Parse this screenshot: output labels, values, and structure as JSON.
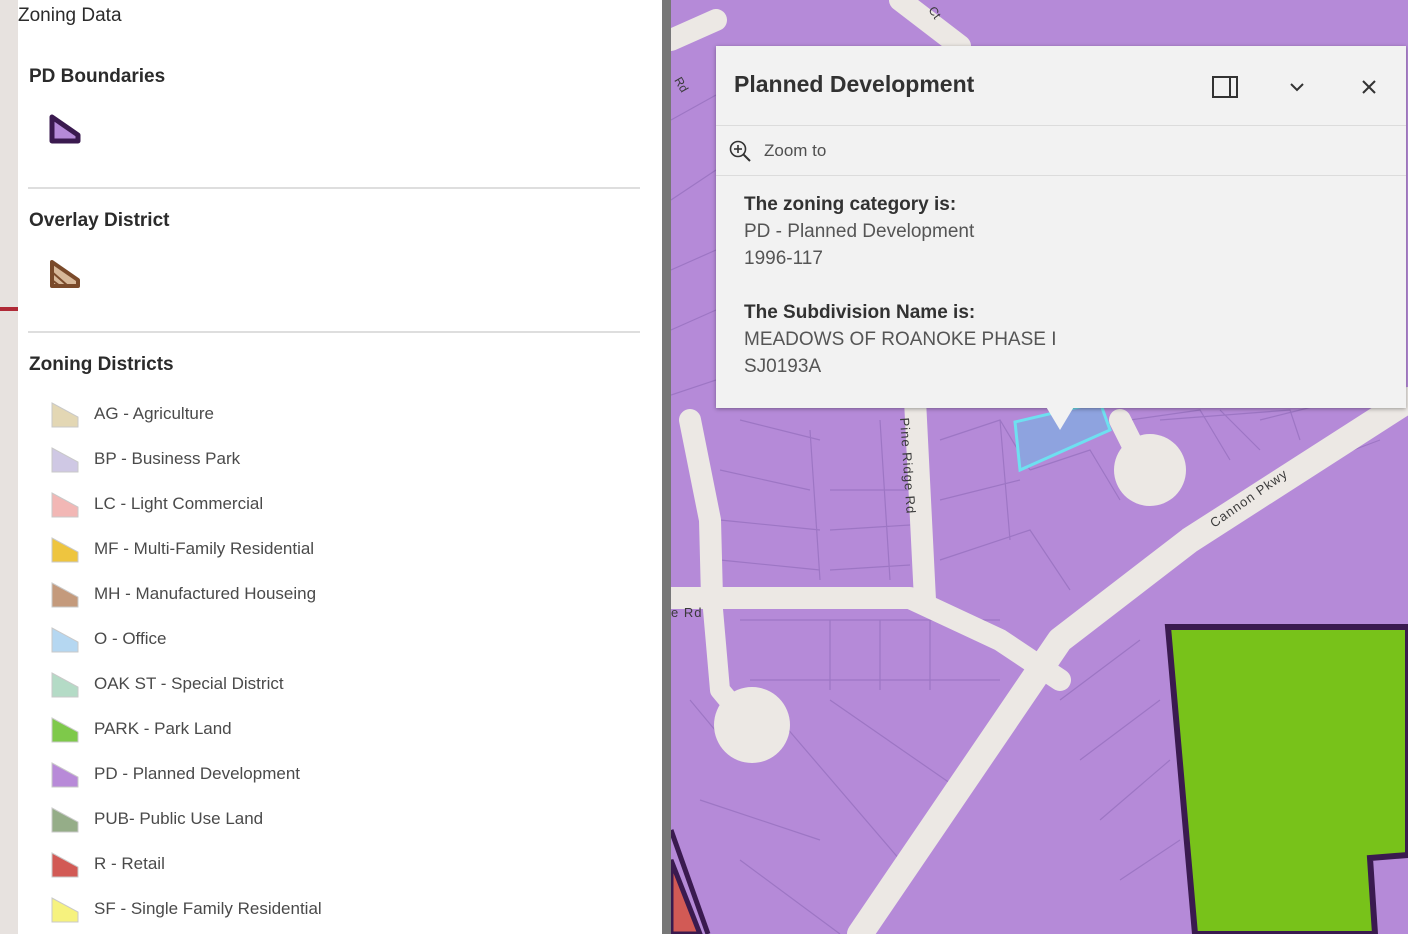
{
  "legend": {
    "title": "Zoning Data",
    "sections": {
      "pd": {
        "title": "PD Boundaries"
      },
      "overlay": {
        "title": "Overlay District"
      },
      "zoning": {
        "title": "Zoning Districts"
      }
    },
    "items": [
      {
        "label": "AG - Agriculture",
        "color": "#e3d7b4"
      },
      {
        "label": "BP - Business Park",
        "color": "#cfc8e4"
      },
      {
        "label": "LC - Light Commercial",
        "color": "#f2b7b5"
      },
      {
        "label": "MF - Multi-Family Residential",
        "color": "#eec53f"
      },
      {
        "label": "MH - Manufactured Houseing",
        "color": "#c49a7c"
      },
      {
        "label": "O - Office",
        "color": "#b5d7f1"
      },
      {
        "label": "OAK ST - Special District",
        "color": "#b4dbc6"
      },
      {
        "label": "PARK - Park Land",
        "color": "#7ec94a"
      },
      {
        "label": "PD - Planned Development",
        "color": "#b88ad8"
      },
      {
        "label": "PUB- Public Use Land",
        "color": "#95ad88"
      },
      {
        "label": "R - Retail",
        "color": "#d25a55"
      },
      {
        "label": "SF - Single Family Residential",
        "color": "#f6f27e"
      }
    ]
  },
  "map": {
    "streets": {
      "pine_ridge": "Pine Ridge Rd",
      "cannon": "Cannon Pkwy",
      "left_rd": "e Rd",
      "top_rd": "Rd",
      "top_ct": "Ct"
    }
  },
  "popup": {
    "title": "Planned Development",
    "zoom_label": "Zoom to",
    "fields": [
      {
        "label": "The zoning category is:",
        "lines": [
          "PD - Planned Development",
          "1996-117"
        ]
      },
      {
        "label": "The Subdivision Name is:",
        "lines": [
          "MEADOWS OF ROANOKE PHASE I",
          "SJ0193A"
        ]
      }
    ]
  },
  "colors": {
    "pd_fill": "#b58ad8",
    "park_fill": "#78c21a",
    "boundary": "#3a1a4f",
    "overlay_brown": "#7a4a2a",
    "selection": "#6ee0f0",
    "road": "#ece8e4"
  }
}
